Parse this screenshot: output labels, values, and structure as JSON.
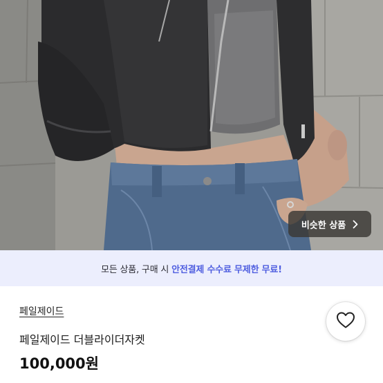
{
  "product_image": {
    "alt": "",
    "similar_button": {
      "label": "비슷한 상품",
      "icon": "chevron-right-icon"
    }
  },
  "promo_banner": {
    "text_before": "모든 상품, 구매 시 ",
    "accent_text": "안전결제 수수료 무제한 무료!",
    "accent_color": "#4f5ee0",
    "background": "#eceefd"
  },
  "product": {
    "seller": "페일제이드",
    "title": "페일제이드 더블라이더자켓",
    "price": "100,000원"
  },
  "actions": {
    "like_icon": "heart-outline-icon"
  }
}
